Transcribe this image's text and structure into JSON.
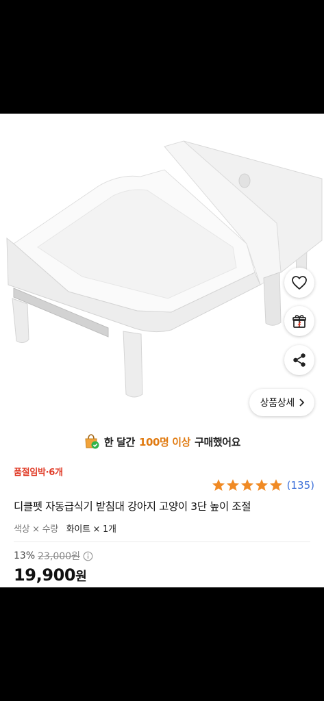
{
  "overlay": {
    "detail_button_label": "상품상세"
  },
  "banner": {
    "prefix": "한 달간",
    "highlight": "100명 이상",
    "suffix": "구매했어요"
  },
  "product": {
    "stock_notice": "품절임박·6개",
    "rating": {
      "stars": 5,
      "max": 5,
      "count": "(135)"
    },
    "title": "디클펫 자동급식기 받침대 강아지 고양이 3단 높이 조절",
    "option_label": "색상 × 수량",
    "option_value": "화이트 × 1개",
    "discount": "13%",
    "original_price": "23,000원",
    "price": "19,900",
    "price_unit": "원"
  },
  "icons": {
    "wish": "heart-outline-icon",
    "gift": "gift-icon",
    "share": "share-icon",
    "detail": "chevron-right-icon",
    "banner": "shopping-bag-check-icon",
    "info": "info-circle-icon"
  },
  "colors": {
    "stock_red": "#e03c28",
    "highlight_orange": "#e07a10",
    "star_orange": "#f08a24",
    "rating_blue": "#3b6fd9"
  }
}
